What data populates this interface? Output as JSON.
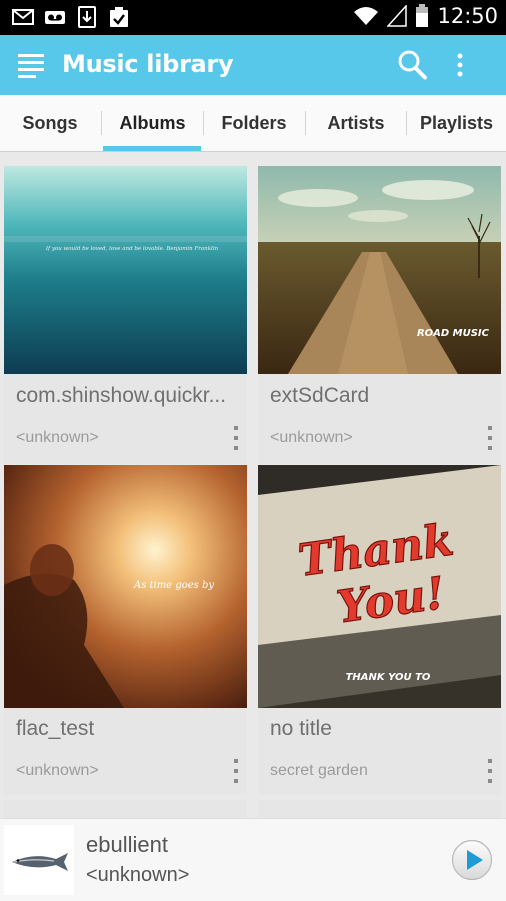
{
  "status_bar": {
    "time": "12:50",
    "icons": [
      "gmail-icon",
      "voicemail-icon",
      "download-icon",
      "clipboard-check-icon",
      "wifi-icon",
      "signal-icon",
      "battery-icon"
    ]
  },
  "app_bar": {
    "title": "Music library",
    "accent_color": "#57c7ea",
    "icons": [
      "menu-icon",
      "search-icon",
      "more-vert-icon"
    ]
  },
  "tabs": [
    {
      "label": "Songs",
      "active": false
    },
    {
      "label": "Albums",
      "active": true
    },
    {
      "label": "Folders",
      "active": false
    },
    {
      "label": "Artists",
      "active": false
    },
    {
      "label": "Playlists",
      "active": false
    }
  ],
  "albums": [
    {
      "title": "com.shinshow.quickr...",
      "artist": "<unknown>",
      "art_caption": "If you would be loved, love and be lovable. Benjamin Franklin"
    },
    {
      "title": "extSdCard",
      "artist": "<unknown>",
      "art_caption": "ROAD MUSIC"
    },
    {
      "title": "flac_test",
      "artist": "<unknown>",
      "art_caption": "As time goes by"
    },
    {
      "title": "no title",
      "artist": "secret garden",
      "art_caption": "THANK YOU TO"
    }
  ],
  "now_playing": {
    "title": "ebullient",
    "artist": "<unknown>",
    "icons": [
      "fish-album-art",
      "play-icon"
    ]
  }
}
